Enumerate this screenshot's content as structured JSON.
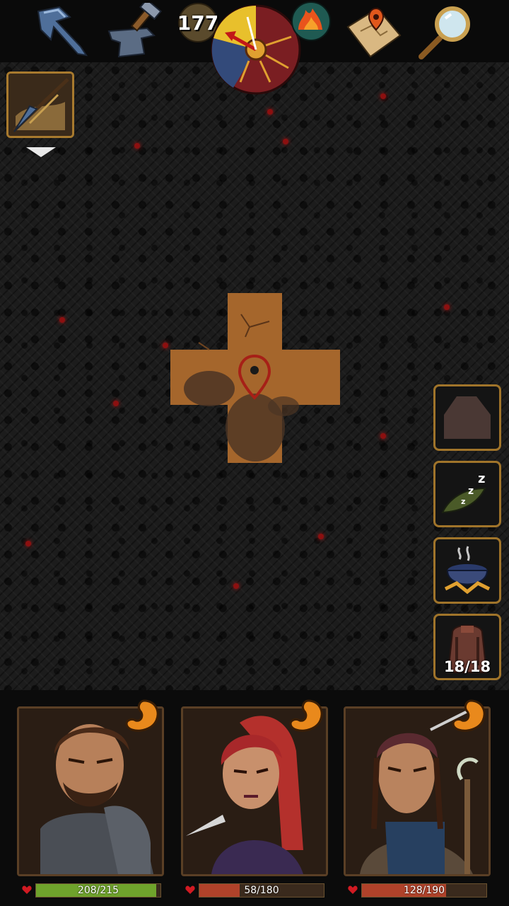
{
  "hud": {
    "day_counter": "177",
    "icons": [
      "crossbow-arrow-icon",
      "anvil-hammer-icon",
      "day-night-dial-icon",
      "campfire-icon",
      "treasure-map-icon",
      "magnifier-icon"
    ]
  },
  "side_panel": {
    "inventory_count": "18/18",
    "buttons": [
      "shelter-button",
      "sleep-button",
      "cooking-pot-button",
      "backpack-button"
    ]
  },
  "party": [
    {
      "hp": "208/215",
      "hp_fraction": 0.967,
      "bar_color": "#6fa32c"
    },
    {
      "hp": "58/180",
      "hp_fraction": 0.322,
      "bar_color": "#b0422a"
    },
    {
      "hp": "128/190",
      "hp_fraction": 0.674,
      "bar_color": "#b0422a"
    }
  ],
  "colors": {
    "accent_gold": "#a87a2e",
    "dirt": "#a5662c",
    "hp_good": "#6fa32c",
    "hp_low": "#b0422a"
  }
}
